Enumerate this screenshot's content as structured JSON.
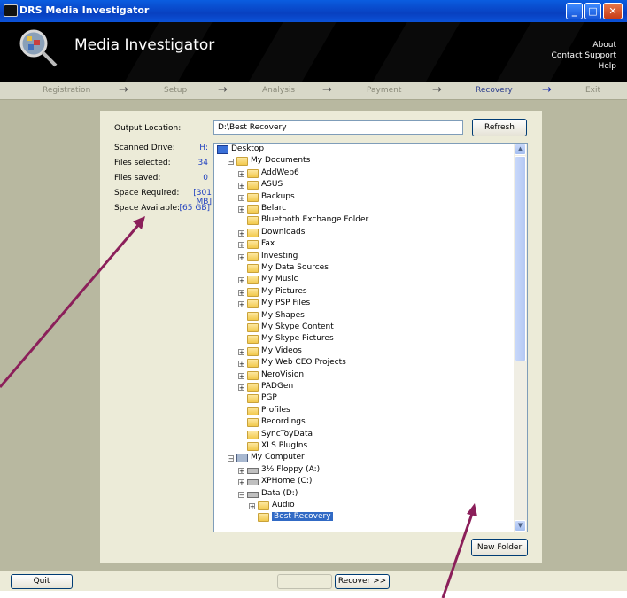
{
  "window": {
    "title": "DRS Media Investigator"
  },
  "header": {
    "app_title": "Media Investigator",
    "links": [
      "About",
      "Contact Support",
      "Help"
    ]
  },
  "steps": {
    "items": [
      "Registration",
      "Setup",
      "Analysis",
      "Payment",
      "Recovery",
      "Exit"
    ],
    "active": "Recovery",
    "arrow": "→"
  },
  "output": {
    "label": "Output Location:",
    "value": "D:\\Best Recovery",
    "refresh_label": "Refresh"
  },
  "stats": {
    "scanned_drive_label": "Scanned Drive:",
    "scanned_drive": "H:",
    "files_selected_label": "Files selected:",
    "files_selected": "34",
    "files_saved_label": "Files saved:",
    "files_saved": "0",
    "space_required_label": "Space Required:",
    "space_required": "[301 MB]",
    "space_available_label": "Space Available:",
    "space_available": "[65 GB]"
  },
  "tree": {
    "rows": [
      {
        "label": "Desktop",
        "icon": "desktop-icon",
        "expander": ""
      },
      {
        "label": "My Documents",
        "icon": "documents-folder-icon",
        "expander": "−"
      },
      {
        "label": "AddWeb6",
        "icon": "folder-icon",
        "expander": "+"
      },
      {
        "label": "ASUS",
        "icon": "folder-icon",
        "expander": "+"
      },
      {
        "label": "Backups",
        "icon": "folder-icon",
        "expander": "+"
      },
      {
        "label": "Belarc",
        "icon": "folder-icon",
        "expander": "+"
      },
      {
        "label": "Bluetooth Exchange Folder",
        "icon": "folder-icon",
        "expander": ""
      },
      {
        "label": "Downloads",
        "icon": "folder-icon",
        "expander": "+"
      },
      {
        "label": "Fax",
        "icon": "folder-icon",
        "expander": "+"
      },
      {
        "label": "Investing",
        "icon": "folder-icon",
        "expander": "+"
      },
      {
        "label": "My Data Sources",
        "icon": "data-sources-icon",
        "expander": ""
      },
      {
        "label": "My Music",
        "icon": "music-folder-icon",
        "expander": "+"
      },
      {
        "label": "My Pictures",
        "icon": "pictures-folder-icon",
        "expander": "+"
      },
      {
        "label": "My PSP Files",
        "icon": "folder-icon",
        "expander": "+"
      },
      {
        "label": "My Shapes",
        "icon": "shapes-folder-icon",
        "expander": ""
      },
      {
        "label": "My Skype Content",
        "icon": "folder-icon",
        "expander": ""
      },
      {
        "label": "My Skype Pictures",
        "icon": "folder-icon",
        "expander": ""
      },
      {
        "label": "My Videos",
        "icon": "videos-folder-icon",
        "expander": "+"
      },
      {
        "label": "My Web CEO Projects",
        "icon": "folder-icon",
        "expander": "+"
      },
      {
        "label": "NeroVision",
        "icon": "folder-icon",
        "expander": "+"
      },
      {
        "label": "PADGen",
        "icon": "folder-icon",
        "expander": "+"
      },
      {
        "label": "PGP",
        "icon": "folder-icon",
        "expander": ""
      },
      {
        "label": "Profiles",
        "icon": "folder-icon",
        "expander": ""
      },
      {
        "label": "Recordings",
        "icon": "folder-icon",
        "expander": ""
      },
      {
        "label": "SyncToyData",
        "icon": "folder-icon",
        "expander": ""
      },
      {
        "label": "XLS PlugIns",
        "icon": "folder-icon",
        "expander": ""
      },
      {
        "label": "My Computer",
        "icon": "computer-icon",
        "expander": "−"
      },
      {
        "label": "3½ Floppy (A:)",
        "icon": "floppy-icon",
        "expander": "+"
      },
      {
        "label": "XPHome (C:)",
        "icon": "drive-icon",
        "expander": "+"
      },
      {
        "label": "Data (D:)",
        "icon": "drive-icon",
        "expander": "−"
      },
      {
        "label": "Audio",
        "icon": "folder-icon",
        "expander": "+"
      },
      {
        "label": "Best Recovery",
        "icon": "folder-open-icon",
        "expander": "",
        "selected": true
      }
    ]
  },
  "buttons": {
    "new_folder": "New Folder",
    "quit": "Quit",
    "recover": "Recover >>"
  },
  "colors": {
    "title_bar": "#0a5de0",
    "header_bg": "#000000",
    "panel_bg": "#ecebd8",
    "selection": "#316ac5",
    "annotation_arrow": "#8b1f5a"
  }
}
